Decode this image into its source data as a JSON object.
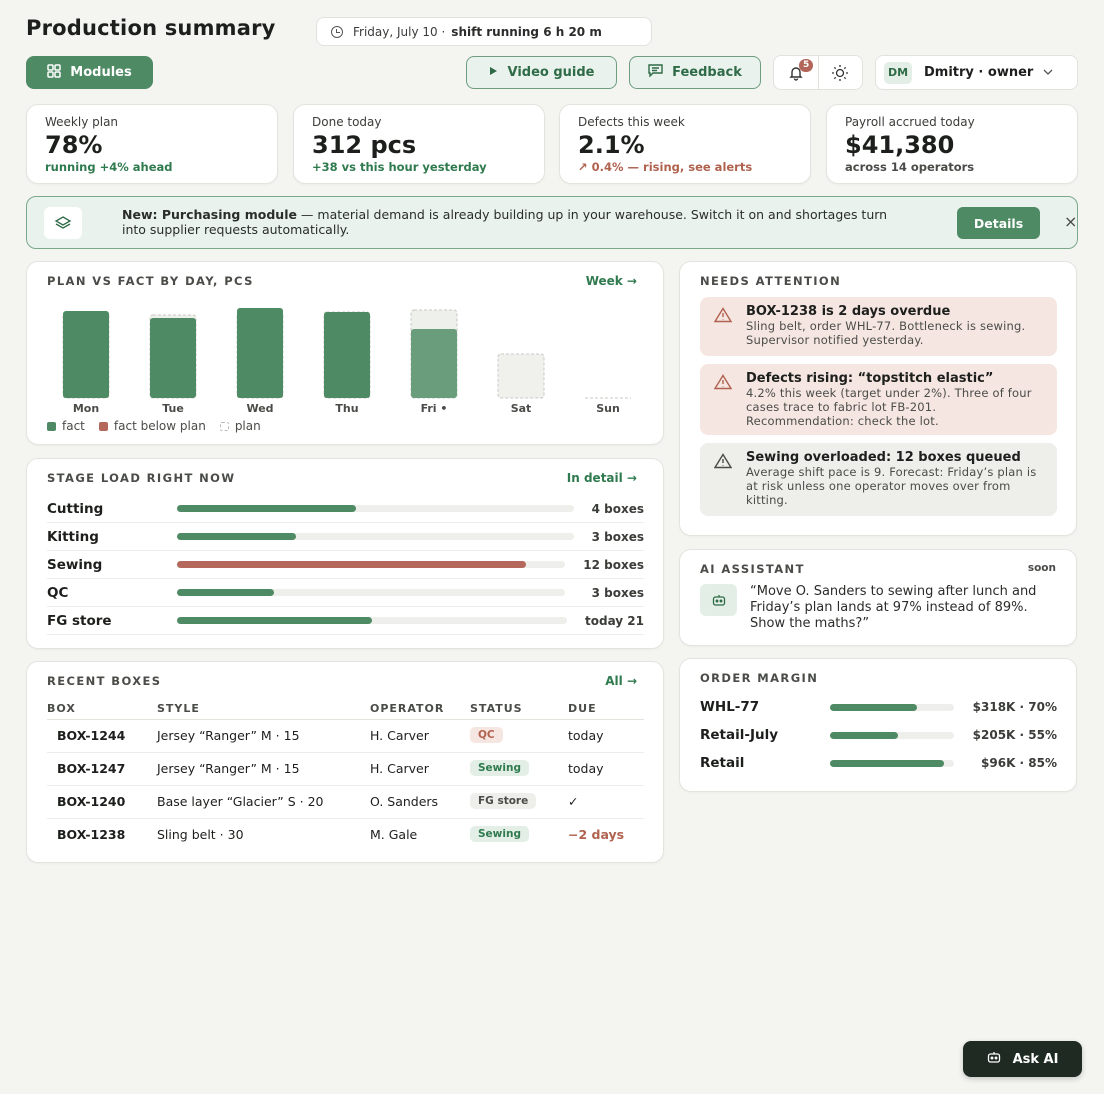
{
  "header": {
    "title": "Production summary",
    "date": "Friday, July 10 ·",
    "shift": "shift running 6 h 20 m",
    "modules_label": "Modules",
    "video_label": "Video guide",
    "feedback_label": "Feedback",
    "notifications_count": "5",
    "user_initials": "DM",
    "user_name": "Dmitry · owner"
  },
  "stats": [
    {
      "label": "Weekly plan",
      "value": "78%",
      "sub": "running +4% ahead"
    },
    {
      "label": "Done today",
      "value": "312 pcs",
      "sub": "+38 vs this hour yesterday"
    },
    {
      "label": "Defects this week",
      "value": "2.1%",
      "sub": "↗ 0.4% — rising, see alerts"
    },
    {
      "label": "Payroll accrued today",
      "value": "$41,380",
      "sub": "across 14 operators"
    }
  ],
  "banner": {
    "bold": "New: Purchasing module",
    "text": " — material demand is already building up in your warehouse. Switch it on and shortages turn into supplier requests automatically.",
    "details_label": "Details",
    "close": "×"
  },
  "plan_chart": {
    "title": "PLAN VS FACT BY DAY, PCS",
    "link": "Week →",
    "legend": {
      "fact": "fact",
      "below": "fact below plan",
      "plan": "plan"
    }
  },
  "chart_data": {
    "type": "bar",
    "title": "PLAN VS FACT BY DAY, PCS",
    "categories": [
      "Mon",
      "Tue",
      "Wed",
      "Thu",
      "Fri •",
      "Sat",
      "Sun"
    ],
    "series": [
      {
        "name": "fact",
        "values": [
          87,
          80,
          90,
          86,
          69,
          0,
          0
        ]
      },
      {
        "name": "plan",
        "values": [
          86,
          83,
          86,
          86,
          88,
          44,
          0
        ]
      }
    ],
    "current_day_index": 4,
    "ylim": [
      0,
      100
    ]
  },
  "stage_load": {
    "title": "STAGE LOAD RIGHT NOW",
    "link": "In detail →",
    "rows": [
      {
        "name": "Cutting",
        "count": "4 boxes",
        "fraction": 0.45,
        "color": "#4e8a63"
      },
      {
        "name": "Kitting",
        "count": "3 boxes",
        "fraction": 0.3,
        "color": "#4e8a63"
      },
      {
        "name": "Sewing",
        "count": "12 boxes",
        "fraction": 0.9,
        "color": "#b4685c"
      },
      {
        "name": "QC",
        "count": "3 boxes",
        "fraction": 0.25,
        "color": "#4e8a63"
      },
      {
        "name": "FG store",
        "count": "today 21",
        "fraction": 0.5,
        "color": "#4e8a63"
      }
    ]
  },
  "recent_boxes": {
    "title": "RECENT BOXES",
    "link": "All →",
    "columns": [
      "BOX",
      "STYLE",
      "OPERATOR",
      "STATUS",
      "DUE"
    ],
    "rows": [
      {
        "box": "BOX-1244",
        "style": "Jersey “Ranger” M · 15",
        "operator": "H. Carver",
        "status": "QC",
        "due": "today"
      },
      {
        "box": "BOX-1247",
        "style": "Jersey “Ranger” M · 15",
        "operator": "H. Carver",
        "status": "Sewing",
        "due": "today"
      },
      {
        "box": "BOX-1240",
        "style": "Base layer “Glacier” S · 20",
        "operator": "O. Sanders",
        "status": "FG store",
        "due": "✓"
      },
      {
        "box": "BOX-1238",
        "style": "Sling belt · 30",
        "operator": "M. Gale",
        "status": "Sewing",
        "due": "−2 days"
      }
    ]
  },
  "attention": {
    "title": "NEEDS ATTENTION",
    "alerts": [
      {
        "title": "BOX-1238 is 2 days overdue",
        "text": "Sling belt, order WHL-77. Bottleneck is sewing. Supervisor notified yesterday."
      },
      {
        "title": "Defects rising: “topstitch elastic”",
        "text": "4.2% this week (target under 2%). Three of four cases trace to fabric lot FB-201. Recommendation: check the lot."
      },
      {
        "title": "Sewing overloaded: 12 boxes queued",
        "text": "Average shift pace is 9. Forecast: Friday’s plan is at risk unless one operator moves over from kitting."
      }
    ]
  },
  "ai_assistant": {
    "title": "AI ASSISTANT",
    "soon": "soon",
    "quote": "“Move O. Sanders to sewing after lunch and Friday’s plan lands at 97% instead of 89%. Show the maths?”"
  },
  "order_margin": {
    "title": "ORDER MARGIN",
    "rows": [
      {
        "name": "WHL-77",
        "value": "$318K · 70%",
        "fraction": 0.7
      },
      {
        "name": "Retail-July",
        "value": "$205K · 55%",
        "fraction": 0.55
      },
      {
        "name": "Retail",
        "value": "$96K · 85%",
        "fraction": 0.92
      }
    ]
  },
  "ask_ai_label": "Ask AI",
  "colors": {
    "accent": "#4e8a63",
    "danger": "#b4685c",
    "background": "#f4f4f1"
  }
}
